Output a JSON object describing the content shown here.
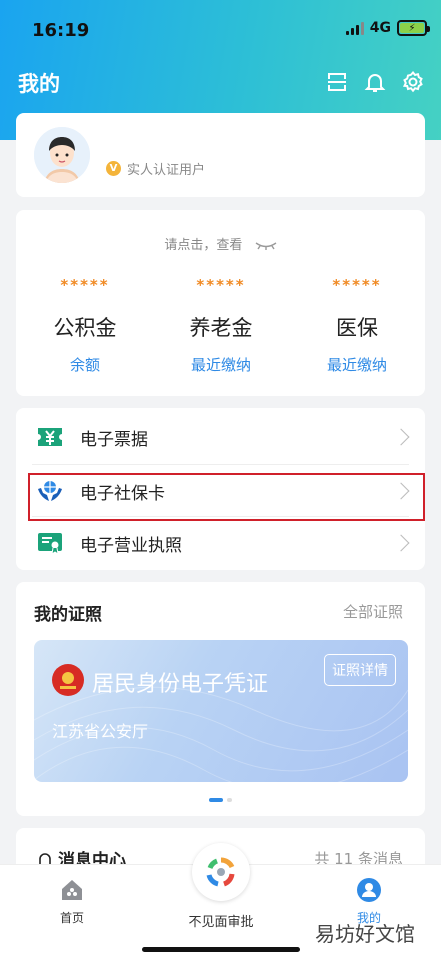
{
  "status_bar": {
    "time": "16:19",
    "network": "4G"
  },
  "header": {
    "title": "我的"
  },
  "profile": {
    "verified_label": "实人认证用户"
  },
  "funds": {
    "hint": "请点击，查看",
    "items": [
      {
        "mask": "*****",
        "name": "公积金",
        "link": "余额"
      },
      {
        "mask": "*****",
        "name": "养老金",
        "link": "最近缴纳"
      },
      {
        "mask": "*****",
        "name": "医保",
        "link": "最近缴纳"
      }
    ]
  },
  "menu": {
    "items": [
      {
        "label": "电子票据",
        "icon": "yuan-receipt-icon"
      },
      {
        "label": "电子社保卡",
        "icon": "hands-globe-icon"
      },
      {
        "label": "电子营业执照",
        "icon": "license-icon"
      }
    ]
  },
  "certificates": {
    "title": "我的证照",
    "all_label": "全部证照",
    "card": {
      "title": "居民身份电子凭证",
      "detail_button": "证照详情",
      "issuer": "江苏省公安厅"
    }
  },
  "messages": {
    "title": "消息中心",
    "count_label": "共 11 条消息"
  },
  "tabbar": {
    "items": [
      {
        "label": "首页",
        "icon": "home-icon"
      },
      {
        "label": "不见面审批",
        "icon": "approval-logo-icon"
      },
      {
        "label": "我的",
        "icon": "user-icon"
      }
    ],
    "active": "我的",
    "active_color": "#2f8ae5"
  },
  "watermark": "易坊好文馆",
  "colors": {
    "header_start": "#1aa4f0",
    "header_end": "#45d1c3",
    "mask": "#f08a24",
    "link": "#2f8ae5",
    "highlight": "#d0202a"
  }
}
